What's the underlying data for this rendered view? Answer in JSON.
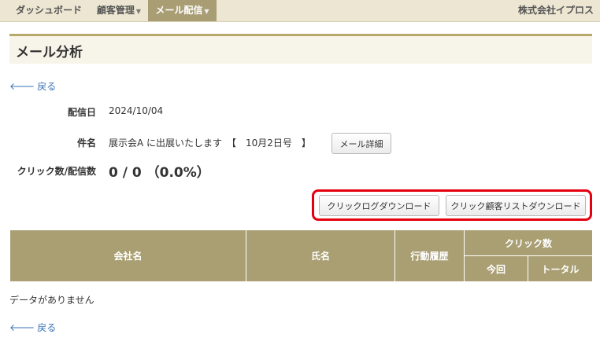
{
  "nav": {
    "items": [
      {
        "label": "ダッシュボード",
        "dropdown": false,
        "active": false
      },
      {
        "label": "顧客管理",
        "dropdown": true,
        "active": false
      },
      {
        "label": "メール配信",
        "dropdown": true,
        "active": true
      }
    ],
    "company": "株式会社イプロス"
  },
  "page": {
    "title": "メール分析",
    "back_label": "戻る"
  },
  "details": {
    "send_date_label": "配信日",
    "send_date_value": "2024/10/04",
    "subject_label": "件名",
    "subject_value": "展示会A に出展いたします　【　10月2日号　】",
    "mail_detail_button": "メール詳細",
    "clicks_label": "クリック数/配信数",
    "clicks_value": "0 / 0 （0.0%）"
  },
  "actions": {
    "click_log_download": "クリックログダウンロード",
    "click_customer_download": "クリック顧客リストダウンロード"
  },
  "table": {
    "headers": {
      "company": "会社名",
      "name": "氏名",
      "history": "行動履歴",
      "clicks": "クリック数",
      "this_time": "今回",
      "total": "トータル"
    },
    "empty_message": "データがありません"
  },
  "colors": {
    "accent": "#a99d74",
    "header_bg": "#aa9f73",
    "link": "#3a73b5",
    "highlight": "#e5000f"
  }
}
